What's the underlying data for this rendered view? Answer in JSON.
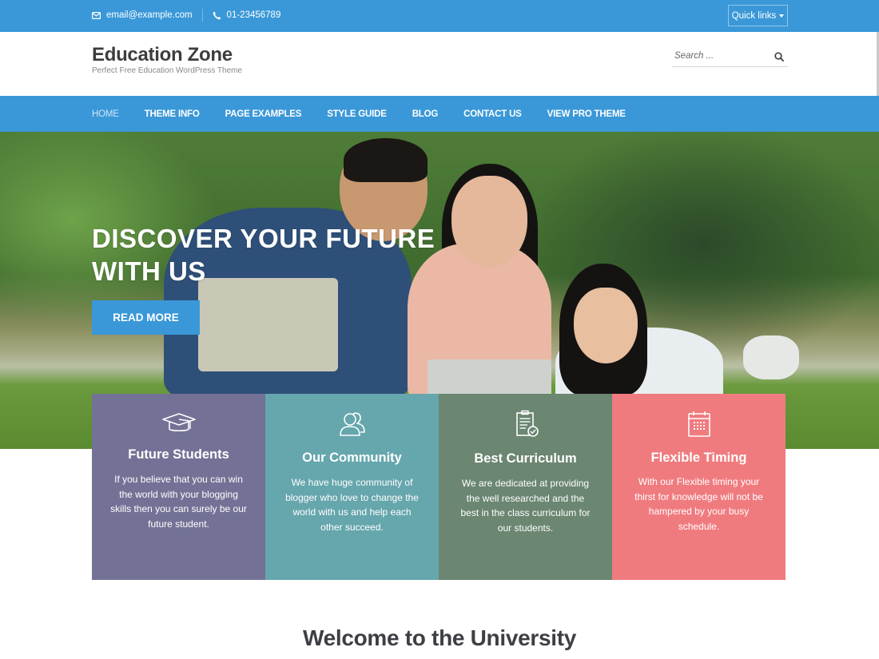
{
  "topbar": {
    "email": "email@example.com",
    "phone": "01-23456789",
    "quick_links_label": "Quick links",
    "email_icon": "envelope-icon",
    "phone_icon": "phone-icon"
  },
  "header": {
    "site_title": "Education Zone",
    "tagline": "Perfect Free Education WordPress Theme",
    "search_placeholder": "Search ...",
    "search_value": ""
  },
  "nav": {
    "items": [
      {
        "label": "HOME",
        "active": true
      },
      {
        "label": "THEME INFO"
      },
      {
        "label": "PAGE EXAMPLES"
      },
      {
        "label": "STYLE GUIDE"
      },
      {
        "label": "BLOG"
      },
      {
        "label": "CONTACT US"
      },
      {
        "label": "VIEW PRO THEME"
      }
    ]
  },
  "hero": {
    "title_line1": "DISCOVER YOUR FUTURE",
    "title_line2": "WITH US",
    "button_label": "READ MORE"
  },
  "features": [
    {
      "icon": "graduation-cap-icon",
      "title": "Future Students",
      "text": "If you believe that you can win the world with your blogging skills then you can surely be our future student.",
      "color": "#737296"
    },
    {
      "icon": "users-icon",
      "title": "Our Community",
      "text": "We have huge community of blogger who love to change the world with us and help each other succeed.",
      "color": "#66a6ad"
    },
    {
      "icon": "clipboard-check-icon",
      "title": "Best Curriculum",
      "text": "We are dedicated at providing the well researched and the best in the class curriculum for our students.",
      "color": "#6b8671"
    },
    {
      "icon": "calendar-icon",
      "title": "Flexible Timing",
      "text": "With our Flexible timing your thirst for knowledge will not be hampered by your busy schedule.",
      "color": "#f07b7f"
    }
  ],
  "welcome": {
    "heading": "Welcome to the University"
  },
  "colors": {
    "primary": "#3a98d8",
    "text_dark": "#3d3d3d"
  }
}
